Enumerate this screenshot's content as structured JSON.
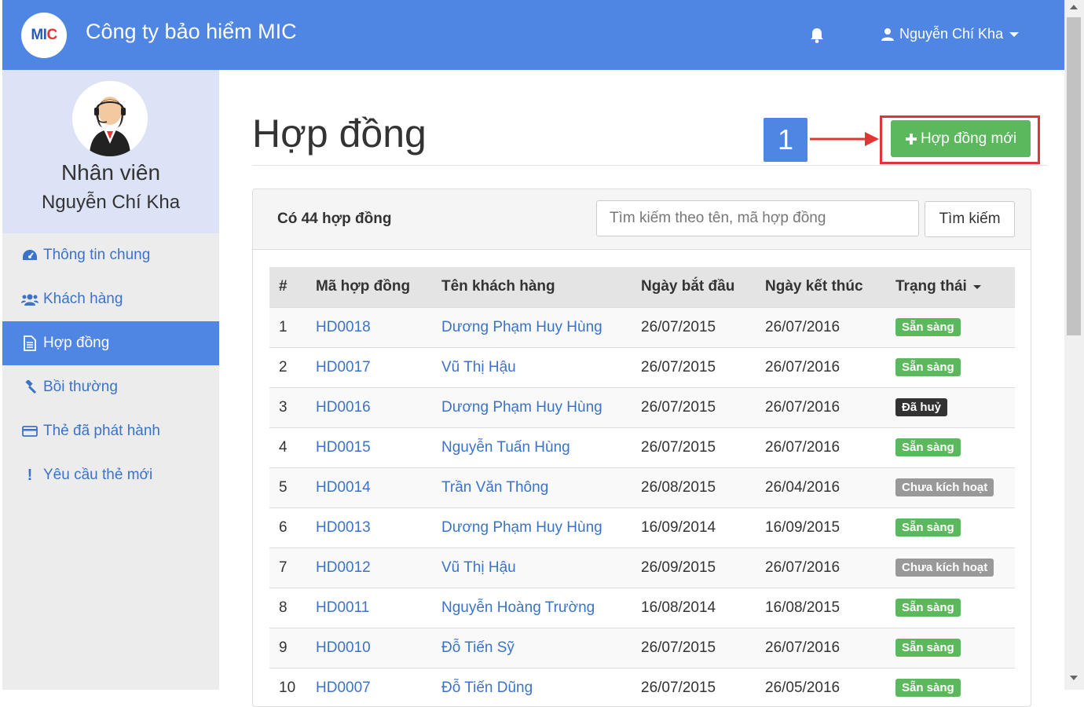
{
  "app": {
    "logo_text_1": "MI",
    "logo_text_2": "C",
    "brand": "Công ty bảo hiểm MIC",
    "user_name": "Nguyễn Chí Kha",
    "accent_color": "#4f86e4"
  },
  "sidebar": {
    "role": "Nhân viên",
    "name": "Nguyễn Chí Kha",
    "items": [
      {
        "label": "Thông tin chung",
        "icon": "dashboard-icon"
      },
      {
        "label": "Khách hàng",
        "icon": "users-icon"
      },
      {
        "label": "Hợp đồng",
        "icon": "document-icon",
        "active": true
      },
      {
        "label": "Bồi thường",
        "icon": "gavel-icon"
      },
      {
        "label": "Thẻ đã phát hành",
        "icon": "card-icon"
      },
      {
        "label": "Yêu cầu thẻ mới",
        "icon": "exclamation-icon"
      }
    ]
  },
  "main": {
    "title": "Hợp đồng",
    "step_number": "1",
    "new_button_label": "Hợp đồng mới",
    "count_text": "Có 44 hợp đồng",
    "search_placeholder": "Tìm kiếm theo tên, mã hợp đồng",
    "search_button": "Tìm kiếm"
  },
  "table": {
    "columns": [
      "#",
      "Mã hợp đồng",
      "Tên khách hàng",
      "Ngày bắt đầu",
      "Ngày kết thúc",
      "Trạng thái"
    ],
    "rows": [
      {
        "no": "1",
        "code": "HD0018",
        "customer": "Dương Phạm Huy Hùng",
        "start": "26/07/2015",
        "end": "26/07/2016",
        "status": "Sẵn sàng",
        "status_color": "#5cb85c"
      },
      {
        "no": "2",
        "code": "HD0017",
        "customer": "Vũ Thị Hậu",
        "start": "26/07/2015",
        "end": "26/07/2016",
        "status": "Sẵn sàng",
        "status_color": "#5cb85c"
      },
      {
        "no": "3",
        "code": "HD0016",
        "customer": "Dương Phạm Huy Hùng",
        "start": "26/07/2015",
        "end": "26/07/2016",
        "status": "Đã huỷ",
        "status_color": "#333333"
      },
      {
        "no": "4",
        "code": "HD0015",
        "customer": "Nguyễn Tuấn Hùng",
        "start": "26/07/2015",
        "end": "26/07/2016",
        "status": "Sẵn sàng",
        "status_color": "#5cb85c"
      },
      {
        "no": "5",
        "code": "HD0014",
        "customer": "Trần Văn Thông",
        "start": "26/08/2015",
        "end": "26/04/2016",
        "status": "Chưa kích hoạt",
        "status_color": "#999999"
      },
      {
        "no": "6",
        "code": "HD0013",
        "customer": "Dương Phạm Huy Hùng",
        "start": "16/09/2014",
        "end": "16/09/2015",
        "status": "Sẵn sàng",
        "status_color": "#5cb85c"
      },
      {
        "no": "7",
        "code": "HD0012",
        "customer": "Vũ Thị Hậu",
        "start": "26/09/2015",
        "end": "26/07/2016",
        "status": "Chưa kích hoạt",
        "status_color": "#999999"
      },
      {
        "no": "8",
        "code": "HD0011",
        "customer": "Nguyễn Hoàng Trường",
        "start": "16/08/2014",
        "end": "16/08/2015",
        "status": "Sẵn sàng",
        "status_color": "#5cb85c"
      },
      {
        "no": "9",
        "code": "HD0010",
        "customer": "Đỗ Tiến Sỹ",
        "start": "26/07/2015",
        "end": "26/07/2016",
        "status": "Sẵn sàng",
        "status_color": "#5cb85c"
      },
      {
        "no": "10",
        "code": "HD0007",
        "customer": "Đỗ Tiến Dũng",
        "start": "26/07/2015",
        "end": "26/05/2016",
        "status": "Sẵn sàng",
        "status_color": "#5cb85c"
      }
    ]
  }
}
